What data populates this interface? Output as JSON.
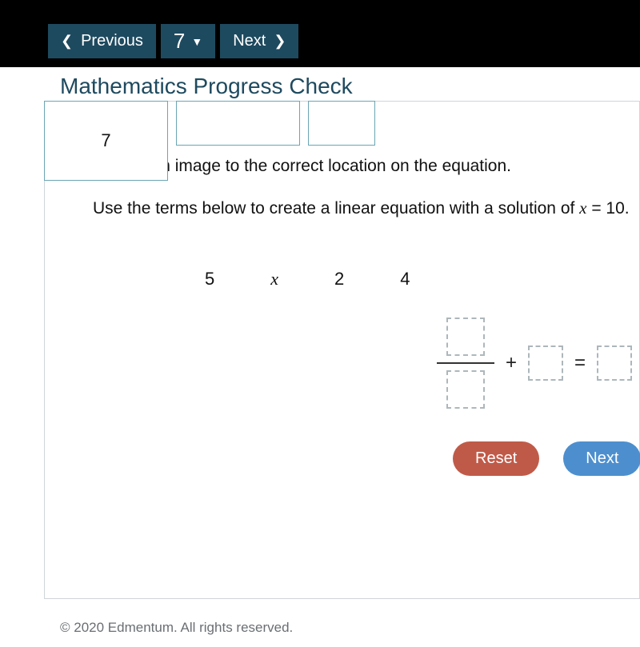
{
  "nav": {
    "previous": "Previous",
    "current_number": "7",
    "next": "Next"
  },
  "hidden_header": "Mathematics Progress Check",
  "overlay_boxes": {
    "first_value": "7",
    "second_value": "",
    "third_value": ""
  },
  "instructions": {
    "line1": "Drag each image to the correct location on the equation.",
    "line2_pre": "Use the terms below to create a linear equation with a solution of ",
    "line2_var": "x",
    "line2_post": " = 10."
  },
  "terms": {
    "a": "5",
    "b": "x",
    "c": "2",
    "d": "4"
  },
  "equation": {
    "plus": "+",
    "equals": "="
  },
  "buttons": {
    "reset": "Reset",
    "next": "Next"
  },
  "footer": "© 2020 Edmentum. All rights reserved."
}
